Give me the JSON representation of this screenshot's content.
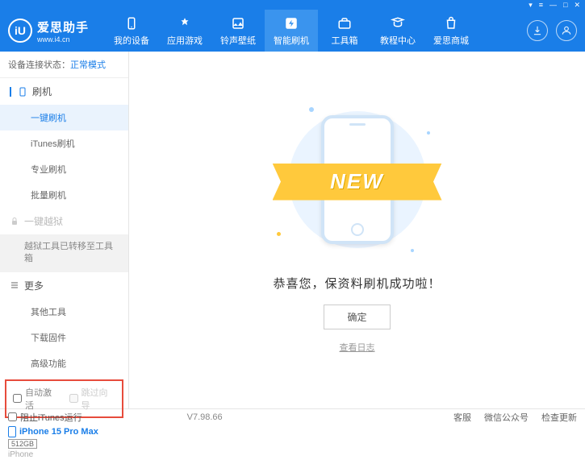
{
  "titlebar": {
    "dropdown": "▾",
    "menu": "≡",
    "min": "—",
    "max": "□",
    "close": "✕"
  },
  "logo": {
    "glyph": "iU",
    "title": "爱思助手",
    "url": "www.i4.cn"
  },
  "nav": [
    {
      "label": "我的设备"
    },
    {
      "label": "应用游戏"
    },
    {
      "label": "铃声壁纸"
    },
    {
      "label": "智能刷机"
    },
    {
      "label": "工具箱"
    },
    {
      "label": "教程中心"
    },
    {
      "label": "爱思商城"
    }
  ],
  "status": {
    "label": "设备连接状态：",
    "mode": "正常模式"
  },
  "sidebar": {
    "s1": {
      "title": "刷机",
      "items": [
        "一键刷机",
        "iTunes刷机",
        "专业刷机",
        "批量刷机"
      ]
    },
    "s2": {
      "title": "一键越狱",
      "note": "越狱工具已转移至工具箱"
    },
    "s3": {
      "title": "更多",
      "items": [
        "其他工具",
        "下载固件",
        "高级功能"
      ]
    }
  },
  "checks": {
    "auto_activate": "自动激活",
    "skip_guide": "跳过向导"
  },
  "device": {
    "name": "iPhone 15 Pro Max",
    "storage": "512GB",
    "type": "iPhone"
  },
  "main": {
    "ribbon": "NEW",
    "success": "恭喜您，保资料刷机成功啦！",
    "ok": "确定",
    "log": "查看日志"
  },
  "footer": {
    "block_itunes": "阻止iTunes运行",
    "version": "V7.98.66",
    "links": [
      "客服",
      "微信公众号",
      "检查更新"
    ]
  }
}
